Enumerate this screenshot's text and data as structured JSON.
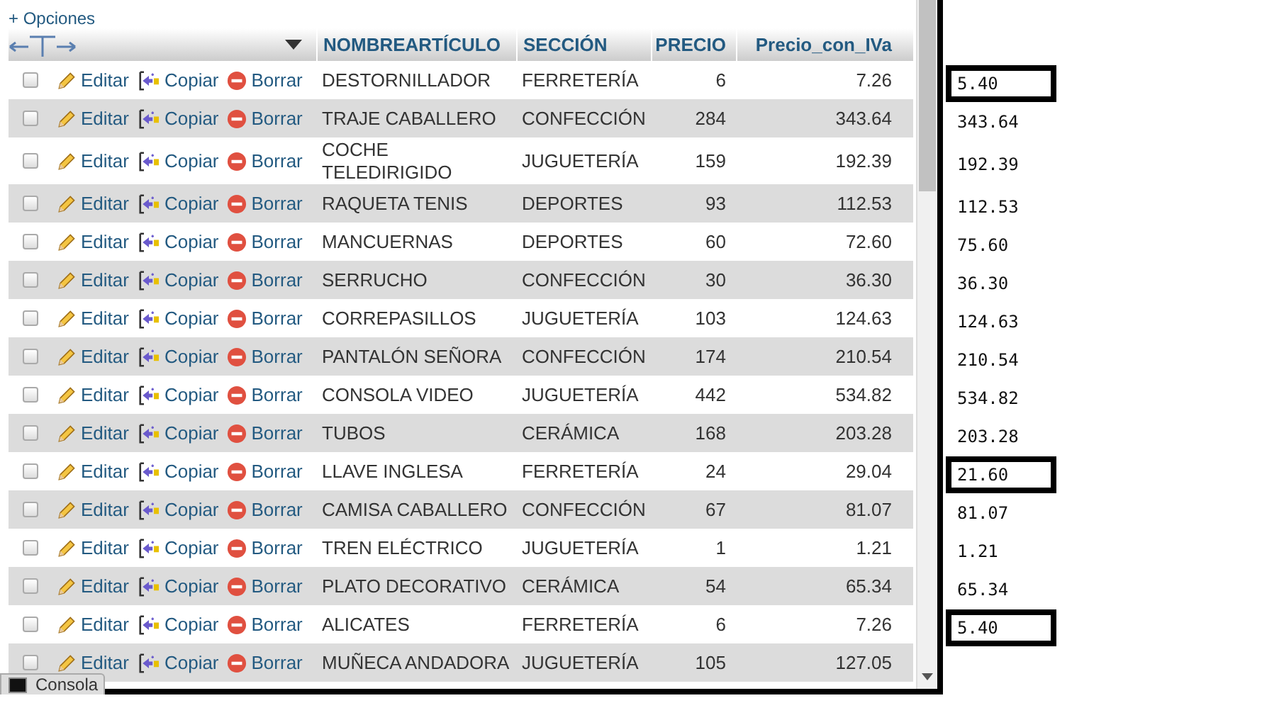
{
  "options_link": "+ Opciones",
  "columns": [
    "NOMBREARTÍCULO",
    "SECCIÓN",
    "PRECIO",
    "Precio_con_IVa"
  ],
  "rows": [
    {
      "checked": false,
      "actions": [
        "Editar",
        "Copiar",
        "Borrar"
      ],
      "cells": [
        "DESTORNILLADOR",
        "FERRETERÍA",
        "6",
        "7.26"
      ]
    },
    {
      "checked": false,
      "actions": [
        "Editar",
        "Copiar",
        "Borrar"
      ],
      "cells": [
        "TRAJE CABALLERO",
        "CONFECCIÓN",
        "284",
        "343.64"
      ]
    },
    {
      "checked": false,
      "actions": [
        "Editar",
        "Copiar",
        "Borrar"
      ],
      "cells": [
        "COCHE TELEDIRIGIDO",
        "JUGUETERÍA",
        "159",
        "192.39"
      ]
    },
    {
      "checked": false,
      "actions": [
        "Editar",
        "Copiar",
        "Borrar"
      ],
      "cells": [
        "RAQUETA TENIS",
        "DEPORTES",
        "93",
        "112.53"
      ]
    },
    {
      "checked": false,
      "actions": [
        "Editar",
        "Copiar",
        "Borrar"
      ],
      "cells": [
        "MANCUERNAS",
        "DEPORTES",
        "60",
        "72.60"
      ]
    },
    {
      "checked": false,
      "actions": [
        "Editar",
        "Copiar",
        "Borrar"
      ],
      "cells": [
        "SERRUCHO",
        "CONFECCIÓN",
        "30",
        "36.30"
      ]
    },
    {
      "checked": false,
      "actions": [
        "Editar",
        "Copiar",
        "Borrar"
      ],
      "cells": [
        "CORREPASILLOS",
        "JUGUETERÍA",
        "103",
        "124.63"
      ]
    },
    {
      "checked": false,
      "actions": [
        "Editar",
        "Copiar",
        "Borrar"
      ],
      "cells": [
        "PANTALÓN SEÑORA",
        "CONFECCIÓN",
        "174",
        "210.54"
      ]
    },
    {
      "checked": false,
      "actions": [
        "Editar",
        "Copiar",
        "Borrar"
      ],
      "cells": [
        "CONSOLA VIDEO",
        "JUGUETERÍA",
        "442",
        "534.82"
      ]
    },
    {
      "checked": false,
      "actions": [
        "Editar",
        "Copiar",
        "Borrar"
      ],
      "cells": [
        "TUBOS",
        "CERÁMICA",
        "168",
        "203.28"
      ]
    },
    {
      "checked": false,
      "actions": [
        "Editar",
        "Copiar",
        "Borrar"
      ],
      "cells": [
        "LLAVE INGLESA",
        "FERRETERÍA",
        "24",
        "29.04"
      ]
    },
    {
      "checked": false,
      "actions": [
        "Editar",
        "Copiar",
        "Borrar"
      ],
      "cells": [
        "CAMISA CABALLERO",
        "CONFECCIÓN",
        "67",
        "81.07"
      ]
    },
    {
      "checked": false,
      "actions": [
        "Editar",
        "Copiar",
        "Borrar"
      ],
      "cells": [
        "TREN ELÉCTRICO",
        "JUGUETERÍA",
        "1",
        "1.21"
      ]
    },
    {
      "checked": false,
      "actions": [
        "Editar",
        "Copiar",
        "Borrar"
      ],
      "cells": [
        "PLATO DECORATIVO",
        "CERÁMICA",
        "54",
        "65.34"
      ]
    },
    {
      "checked": false,
      "actions": [
        "Editar",
        "Copiar",
        "Borrar"
      ],
      "cells": [
        "ALICATES",
        "FERRETERÍA",
        "6",
        "7.26"
      ]
    },
    {
      "checked": false,
      "actions": [
        "Editar",
        "Copiar",
        "Borrar"
      ],
      "cells": [
        "MUÑECA ANDADORA",
        "JUGUETERÍA",
        "105",
        "127.05"
      ]
    }
  ],
  "side_values": [
    {
      "value": "5.40",
      "boxed": true
    },
    {
      "value": "343.64",
      "boxed": false
    },
    {
      "value": "192.39",
      "boxed": false
    },
    {
      "value": "112.53",
      "boxed": false
    },
    {
      "value": "75.60",
      "boxed": false
    },
    {
      "value": "36.30",
      "boxed": false
    },
    {
      "value": "124.63",
      "boxed": false
    },
    {
      "value": "210.54",
      "boxed": false
    },
    {
      "value": "534.82",
      "boxed": false
    },
    {
      "value": "203.28",
      "boxed": false
    },
    {
      "value": "21.60",
      "boxed": true
    },
    {
      "value": "81.07",
      "boxed": false
    },
    {
      "value": "1.21",
      "boxed": false
    },
    {
      "value": "65.34",
      "boxed": false
    },
    {
      "value": "5.40",
      "boxed": true
    }
  ],
  "console": {
    "label": "Consola"
  }
}
